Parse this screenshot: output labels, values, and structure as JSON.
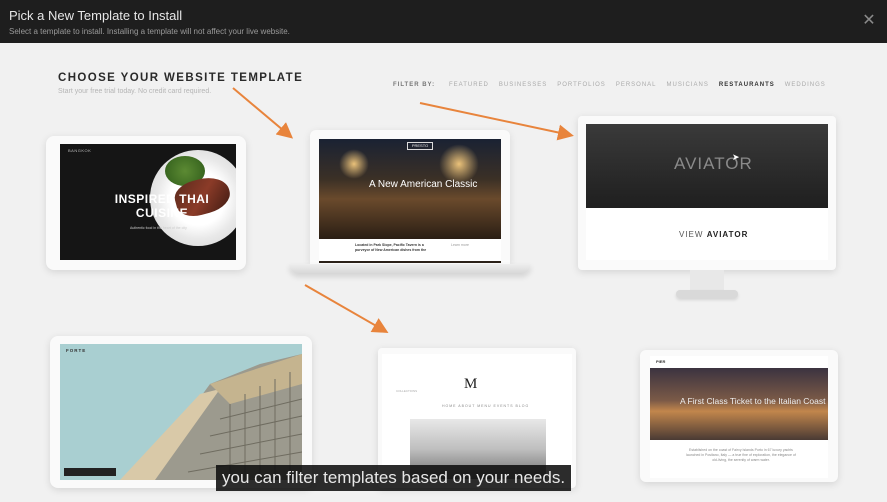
{
  "modal": {
    "title": "Pick a New Template to Install",
    "subtitle": "Select a template to install. Installing a template will not affect your live website.",
    "close_glyph": "✕"
  },
  "page": {
    "title": "CHOOSE YOUR WEBSITE TEMPLATE",
    "subtitle": "Start your free trial today. No credit card required."
  },
  "filter": {
    "label": "FILTER BY:",
    "items": [
      {
        "label": "FEATURED",
        "active": false
      },
      {
        "label": "BUSINESSES",
        "active": false
      },
      {
        "label": "PORTFOLIOS",
        "active": false
      },
      {
        "label": "PERSONAL",
        "active": false
      },
      {
        "label": "MUSICIANS",
        "active": false
      },
      {
        "label": "RESTAURANTS",
        "active": true
      },
      {
        "label": "WEDDINGS",
        "active": false
      }
    ]
  },
  "templates": {
    "thai": {
      "nav": "BANGKOK",
      "title_line1": "INSPIRED THAI",
      "title_line2": "CUISINE",
      "small": "Authentic food in the heart of the city"
    },
    "american": {
      "logo": "PRESTO",
      "title": "A New American Classic",
      "text1": "Located in Park Slope, Pacific Tavern is a purveyor of New American dishes from the",
      "text2": "Learn more"
    },
    "aviator": {
      "title": "AVIATOR",
      "view_prefix": "VIEW",
      "view_name": "AVIATOR"
    },
    "forte": {
      "nav": "FORTE"
    },
    "marquee": {
      "logo": "M",
      "nav": "HOME   ABOUT   MENU   EVENTS   BLOG",
      "small": "COLLECTIONS"
    },
    "coast": {
      "nav": "PIER",
      "title": "A First Class Ticket to the Italian Coast",
      "text": "Established on the coast of Fairvy Islands Porto in 67 luxury yachts launched in Positano, Italy — a true fine of exploration, the elegance of old-living, the serenity of warm water."
    }
  },
  "caption": "you can filter templates based on your needs.",
  "colors": {
    "header_bg": "#1e1e1e",
    "arrow": "#e8843c",
    "page_bg": "#f1f1f1"
  }
}
